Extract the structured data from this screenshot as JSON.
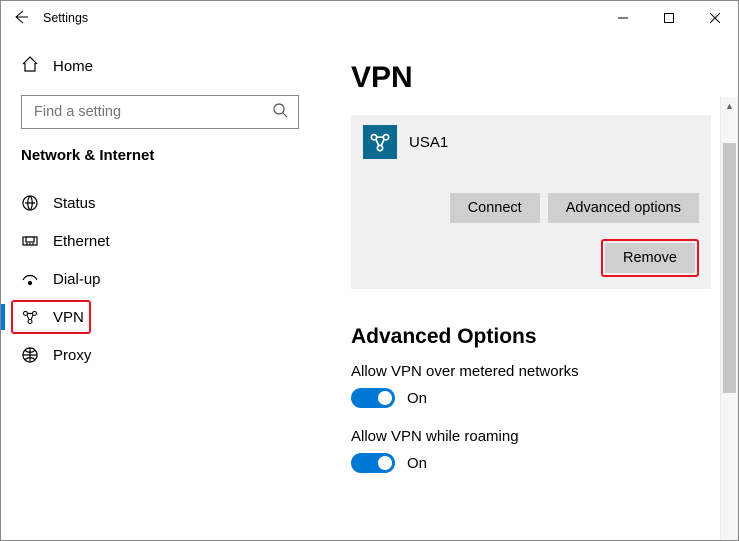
{
  "window": {
    "title": "Settings"
  },
  "sidebar": {
    "home": "Home",
    "search_placeholder": "Find a setting",
    "section": "Network & Internet",
    "items": [
      {
        "label": "Status"
      },
      {
        "label": "Ethernet"
      },
      {
        "label": "Dial-up"
      },
      {
        "label": "VPN"
      },
      {
        "label": "Proxy"
      }
    ]
  },
  "main": {
    "title": "VPN",
    "vpn": {
      "name": "USA1",
      "connect": "Connect",
      "advanced": "Advanced options",
      "remove": "Remove"
    },
    "advanced_options": {
      "title": "Advanced Options",
      "metered_label": "Allow VPN over metered networks",
      "metered_state": "On",
      "roaming_label": "Allow VPN while roaming",
      "roaming_state": "On"
    }
  }
}
